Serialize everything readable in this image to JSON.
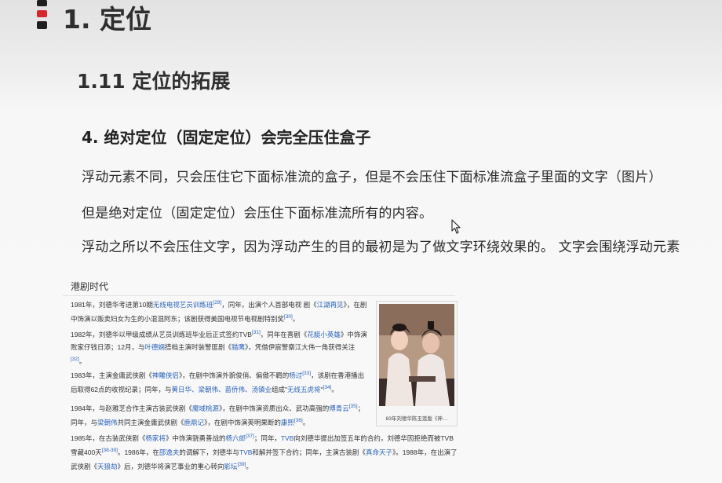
{
  "slide": {
    "title": "1. 定位",
    "subtitle": "1.11 定位的拓展",
    "point": "4. 绝对定位（固定定位）会完全压住盒子",
    "paragraphs": [
      "浮动元素不同，只会压住它下面标准流的盒子，但是不会压住下面标准流盒子里面的文字（图片）",
      "但是绝对定位（固定定位）会压住下面标准流所有的内容。",
      "浮动之所以不会压住文字，因为浮动产生的目的最初是为了做文字环绕效果的。 文字会围绕浮动元素"
    ]
  },
  "wiki": {
    "heading": "港剧时代",
    "p1": {
      "a": "1981年，刘德华考进第10期",
      "link1": "无线电视艺员训练班",
      "ref1": "[29]",
      "b": "，同年，出演个人首部电视 剧《",
      "link2": "江湖再见",
      "c": "》，在剧中饰演以贩卖妇女为生的小混混阿东；该剧获得美国电视节电视剧特别奖",
      "ref2": "[30]",
      "d": "。"
    },
    "p2": {
      "a": "1982年，刘德华以甲级成绩从艺员训练班毕业后正式签约TVB",
      "ref1": "[31]",
      "b": "，同年在喜剧《",
      "link1": "花艇小英雄",
      "c": "》中饰演败家仔钱日添；12月，与",
      "link2": "叶德娴",
      "d": "搭档主演时装警匪剧《",
      "link3": "猎鹰",
      "e": "》，凭借伊宸警察江大伟一角获得关注",
      "ref2": "[32]",
      "f": "。"
    },
    "p3": {
      "a": "1983年，主演金庸武侠剧《",
      "link1": "神雕侠侣",
      "b": "》，在剧中饰演外貌俊俏、偏傲不羁的",
      "link2": "杨过",
      "ref1": "[33]",
      "c": "，该剧在香港播出后取得62点的收视纪录；同年，与",
      "link3": "黄日华、梁朝伟、苗侨伟、汤镇业",
      "d": "组成\"",
      "link4": "无线五虎将",
      "e": "\"",
      "ref2": "[34]",
      "f": "。"
    },
    "p4": {
      "a": "1984年，与赵雅芝合作主演古装武侠剧《",
      "link1": "魔域桃源",
      "b": "》，在剧中饰演资质出众、武功高强的",
      "link2": "傅青云",
      "ref1": "[35]",
      "c": "；同年，与",
      "link3": "梁朝伟",
      "d": "共同主演金庸武侠剧《",
      "link4": "鹿鼎记",
      "e": "》，在剧中饰演英明果断的",
      "link5": "康熙",
      "ref2": "[36]",
      "f": "。"
    },
    "p5": {
      "a": "1985年，在古装武侠剧《",
      "link1": "杨家将",
      "b": "》中饰演骁勇善战的",
      "link2": "杨六郎",
      "ref1": "[37]",
      "c": "；同年，",
      "link3": "TVB",
      "d": "向刘德华提出加签五年的合约，刘德华因拒绝而被TVB雪藏400天",
      "ref2": "[38-39]",
      "e": "。1986年，在",
      "link4": "邵逸夫",
      "f": "的调解下，刘德华与",
      "link5": "TVB",
      "g": "和解并签下合约；同年，主演古装剧《",
      "link6": "真命天子",
      "h": "》。1988年，在出演了武侠剧《",
      "link7": "天狼劫",
      "i": "》后，刘德华将演艺事业的重心转向",
      "link8": "影坛",
      "ref3": "[39]",
      "j": "。"
    },
    "caption": "83年刘德华陈玉莲版《神…"
  }
}
